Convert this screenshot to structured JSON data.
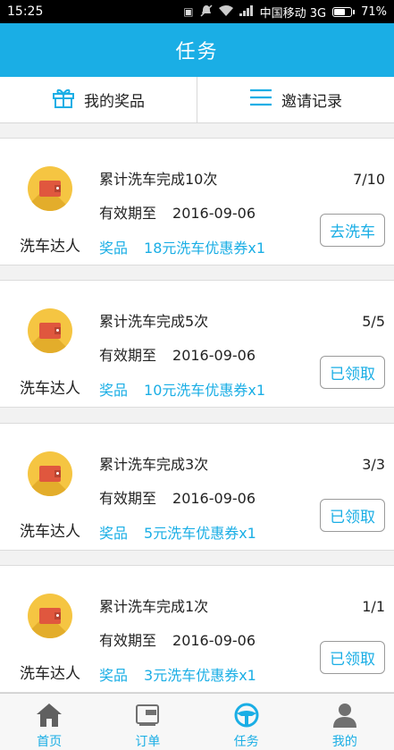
{
  "status_bar": {
    "time": "15:25",
    "carrier": "中国移动 3G",
    "battery": "71%",
    "battery_level": 0.71
  },
  "header": {
    "title": "任务"
  },
  "top_nav": {
    "prizes_label": "我的奖品",
    "prizes_icon": "gift-icon",
    "invites_label": "邀请记录",
    "invites_icon": "list-icon"
  },
  "tasks": [
    {
      "badge": "洗车达人",
      "title": "累计洗车完成10次",
      "expiry_label": "有效期至",
      "expiry_date": "2016-09-06",
      "reward_label": "奖品",
      "reward": "18元洗车优惠券x1",
      "progress": "7/10",
      "action": "去洗车"
    },
    {
      "badge": "洗车达人",
      "title": "累计洗车完成5次",
      "expiry_label": "有效期至",
      "expiry_date": "2016-09-06",
      "reward_label": "奖品",
      "reward": "10元洗车优惠券x1",
      "progress": "5/5",
      "action": "已领取"
    },
    {
      "badge": "洗车达人",
      "title": "累计洗车完成3次",
      "expiry_label": "有效期至",
      "expiry_date": "2016-09-06",
      "reward_label": "奖品",
      "reward": "5元洗车优惠券x1",
      "progress": "3/3",
      "action": "已领取"
    },
    {
      "badge": "洗车达人",
      "title": "累计洗车完成1次",
      "expiry_label": "有效期至",
      "expiry_date": "2016-09-06",
      "reward_label": "奖品",
      "reward": "3元洗车优惠券x1",
      "progress": "1/1",
      "action": "已领取"
    }
  ],
  "tab_bar": {
    "items": [
      {
        "label": "首页",
        "icon": "home-icon"
      },
      {
        "label": "订单",
        "icon": "order-icon"
      },
      {
        "label": "任务",
        "icon": "steering-wheel-icon"
      },
      {
        "label": "我的",
        "icon": "person-icon"
      }
    ]
  },
  "colors": {
    "accent": "#1aaee5",
    "badge_yellow": "#f5c542",
    "wallet_red": "#e0573e"
  }
}
